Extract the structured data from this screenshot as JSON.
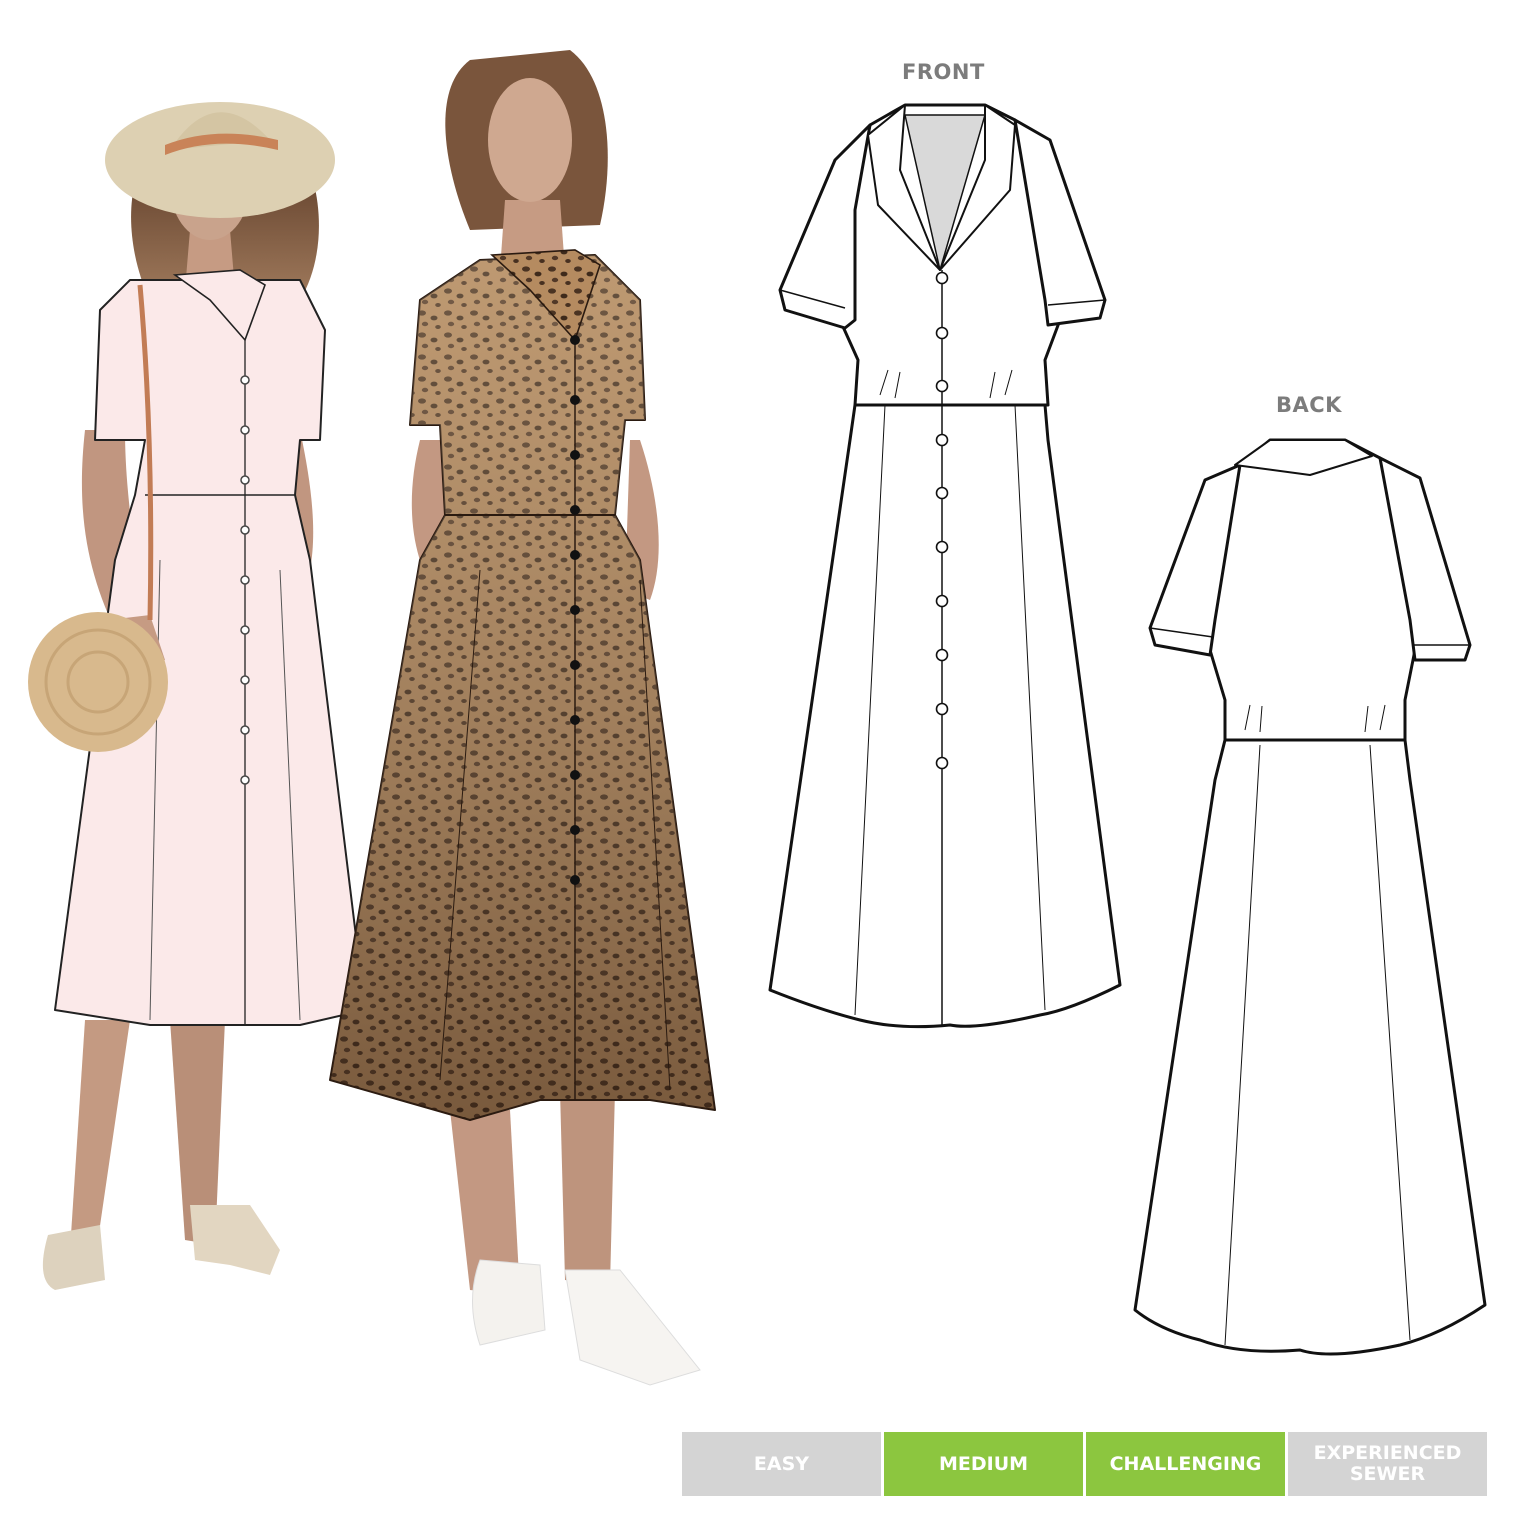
{
  "views": {
    "front_label": "FRONT",
    "back_label": "BACK"
  },
  "difficulty": {
    "levels": [
      {
        "label": "EASY",
        "active": false
      },
      {
        "label": "MEDIUM",
        "active": true
      },
      {
        "label": "CHALLENGING",
        "active": true
      },
      {
        "label": "EXPERIENCED\nSEWER",
        "active": false
      }
    ]
  },
  "colors": {
    "active": "#8cc63f",
    "inactive": "#d4d4d4",
    "skin": "#c69b83",
    "hair": "#6e4a33",
    "pink_dress": "#fbe9e9",
    "leopard_base": "#b08860",
    "hat": "#ddd0b2",
    "outline": "#111111"
  }
}
